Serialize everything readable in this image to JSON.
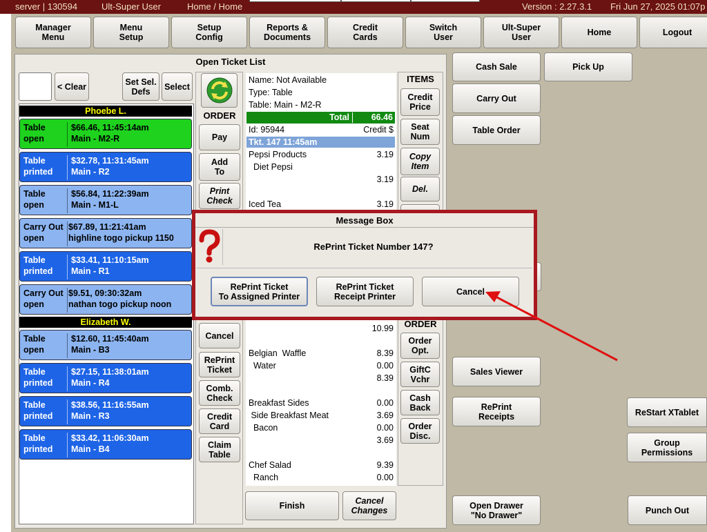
{
  "status": {
    "server": "server | 130594",
    "user": "Ult-Super User",
    "breadcrumb": "Home / Home",
    "version": "Version : 2.27.3.1",
    "datetime": "Fri Jun 27, 2025  01:07p"
  },
  "nav": [
    {
      "label": "Manager\nMenu"
    },
    {
      "label": "Menu\nSetup"
    },
    {
      "label": "Setup\nConfig"
    },
    {
      "label": "Reports &\nDocuments"
    },
    {
      "label": "Credit\nCards"
    },
    {
      "label": "Switch\nUser"
    },
    {
      "label": "Ult-Super\nUser"
    },
    {
      "label": "Home"
    },
    {
      "label": "Logout"
    }
  ],
  "panel": {
    "title": "Open Ticket List",
    "clear_label": "< Clear",
    "setsel_label": "Set Sel.\nDefs",
    "select_label": "Select",
    "order_label": "ORDER",
    "items_label": "ITEMS",
    "order2_label": "ORDER"
  },
  "groups": [
    {
      "name": "Phoebe L."
    },
    {
      "name": "Elizabeth W."
    }
  ],
  "tickets": [
    {
      "type": "Table",
      "state": "open",
      "info": "$66.46, 11:45:14am",
      "loc": "Main - M2-R"
    },
    {
      "type": "Table",
      "state": "printed",
      "info": "$32.78, 11:31:45am",
      "loc": "Main - R2"
    },
    {
      "type": "Table",
      "state": "open",
      "info": "$56.84, 11:22:39am",
      "loc": "Main - M1-L"
    },
    {
      "type": "Carry Out",
      "state": "open",
      "info": "$67.89, 11:21:41am",
      "loc": "highline togo pickup 1150"
    },
    {
      "type": "Table",
      "state": "printed",
      "info": "$33.41, 11:10:15am",
      "loc": "Main - R1"
    },
    {
      "type": "Carry Out",
      "state": "open",
      "info": "$9.51, 09:30:32am",
      "loc": "nathan togo pickup noon"
    },
    {
      "type": "Table",
      "state": "open",
      "info": "$12.60, 11:45:40am",
      "loc": "Main - B3"
    },
    {
      "type": "Table",
      "state": "printed",
      "info": "$27.15, 11:38:01am",
      "loc": "Main - R4"
    },
    {
      "type": "Table",
      "state": "printed",
      "info": "$38.56, 11:16:55am",
      "loc": "Main - R3"
    },
    {
      "type": "Table",
      "state": "printed",
      "info": "$33.42, 11:06:30am",
      "loc": "Main - B4"
    }
  ],
  "order_buttons": {
    "pay": "Pay",
    "add_to": "Add\nTo",
    "print_check": "Print\nCheck",
    "cancel": "Cancel",
    "reprint_ticket": "RePrint\nTicket",
    "comb_check": "Comb.\nCheck",
    "credit_card": "Credit\nCard",
    "claim_table": "Claim\nTable"
  },
  "item_buttons": {
    "credit_price": "Credit\nPrice",
    "seat_num": "Seat\nNum",
    "copy_item": "Copy\nItem",
    "del": "Del.",
    "order_opt": "Order\nOpt.",
    "giftc_vchr": "GiftC\nVchr",
    "cash_back": "Cash\nBack",
    "order_disc": "Order\nDisc."
  },
  "ticket_view": {
    "name": "Name: Not Available",
    "type": "Type: Table",
    "table": "Table: Main - M2-R",
    "total_label": "Total",
    "total_value": "66.46",
    "id": "Id: 95944",
    "credit": "Credit $",
    "tkt": "Tkt. 147  11:45am",
    "lines": [
      {
        "name": "Pepsi Products",
        "price": "3.19"
      },
      {
        "name": "  Diet Pepsi",
        "price": ""
      },
      {
        "name": "",
        "price": "3.19"
      },
      {
        "name": "",
        "price": ""
      },
      {
        "name": "Iced Tea",
        "price": "3.19"
      }
    ],
    "lines2": [
      {
        "name": "",
        "price": "10.99"
      },
      {
        "name": "",
        "price": ""
      },
      {
        "name": "Belgian  Waffle",
        "price": "8.39"
      },
      {
        "name": "  Water",
        "price": "0.00"
      },
      {
        "name": "",
        "price": "8.39"
      },
      {
        "name": "",
        "price": ""
      },
      {
        "name": "Breakfast Sides",
        "price": "0.00"
      },
      {
        "name": " Side Breakfast Meat",
        "price": "3.69"
      },
      {
        "name": "  Bacon",
        "price": "0.00"
      },
      {
        "name": "",
        "price": "3.69"
      },
      {
        "name": "",
        "price": ""
      },
      {
        "name": "Chef Salad",
        "price": "9.39"
      },
      {
        "name": "  Ranch",
        "price": "0.00"
      }
    ]
  },
  "bottom": {
    "finish": "Finish",
    "cancel_changes": "Cancel\nChanges"
  },
  "right": {
    "cash_sale": "Cash Sale",
    "pick_up": "Pick Up",
    "carry_out": "Carry Out",
    "table_order": "Table Order",
    "sales_viewer": "Sales Viewer",
    "reprint_receipts": "RePrint\nReceipts",
    "open_drawer": "Open Drawer\n\"No Drawer\"",
    "restart_xtablet": "ReStart XTablet",
    "group_permissions": "Group\nPermissions",
    "punch_out": "Punch Out"
  },
  "dialog": {
    "title": "Message Box",
    "message": "RePrint Ticket Number 147?",
    "btn_assigned": "RePrint Ticket\nTo Assigned Printer",
    "btn_receipt": "RePrint Ticket\nReceipt Printer",
    "btn_cancel": "Cancel"
  },
  "colors": {
    "statusbar": "#6b1212",
    "ticket_green": "#1ed21e",
    "ticket_blue": "#1e64e6",
    "ticket_light": "#8cb4f0",
    "dialog_border": "#a81820",
    "arrow": "#e01010"
  }
}
